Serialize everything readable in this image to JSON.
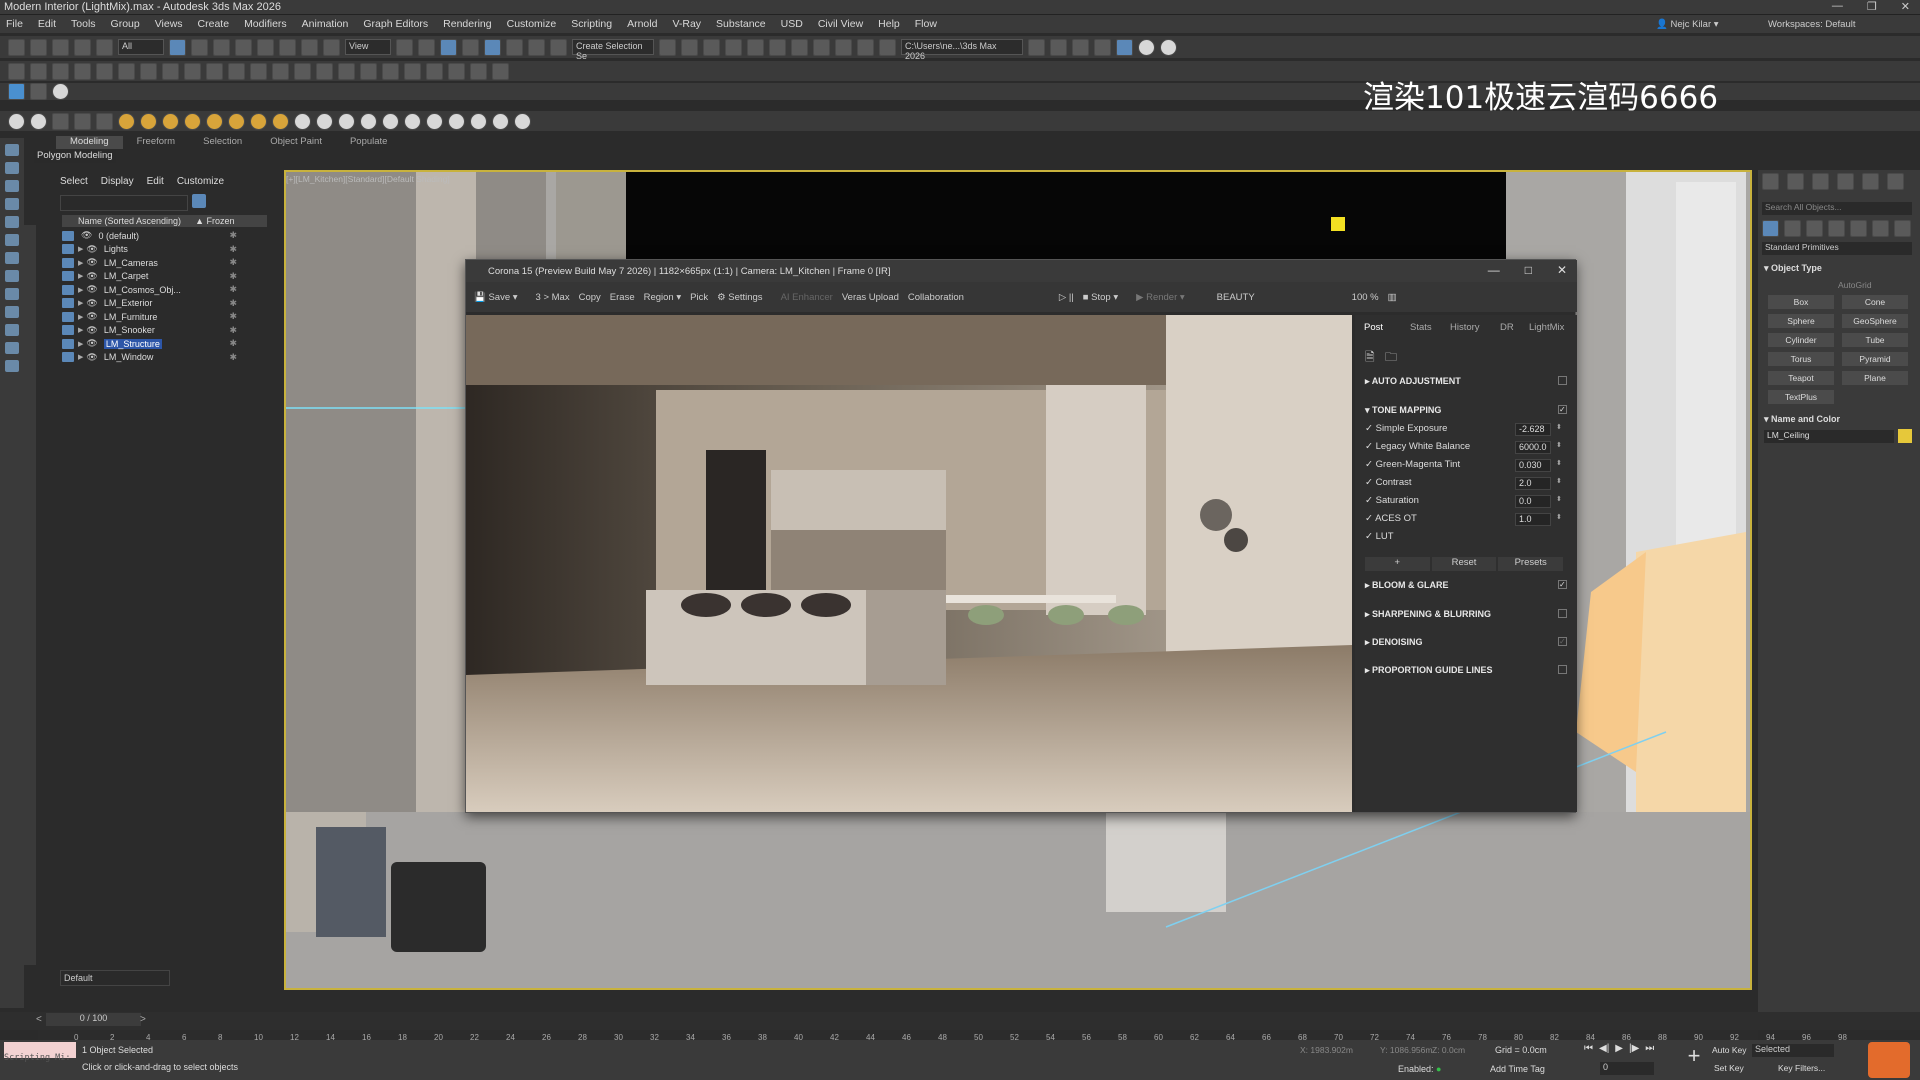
{
  "window": {
    "title": "Modern Interior (LightMix).max - Autodesk 3ds Max 2026",
    "controls": [
      "—",
      "❐",
      "✕"
    ]
  },
  "menu": [
    "File",
    "Edit",
    "Tools",
    "Group",
    "Views",
    "Create",
    "Modifiers",
    "Animation",
    "Graph Editors",
    "Rendering",
    "Customize",
    "Scripting",
    "Arnold",
    "V-Ray",
    "Substance",
    "USD",
    "Civil View",
    "Help",
    "Flow"
  ],
  "user": "Nejc Kilar",
  "workspaces_label": "Workspaces:",
  "workspace": "Default",
  "toolbar": {
    "filter": "All",
    "view": "View",
    "selection_set": "Create Selection Se",
    "path": "C:\\Users\\ne...\\3ds Max 2026"
  },
  "watermark": "渲染101极速云渲码6666",
  "ribbon_tabs": [
    "Modeling",
    "Freeform",
    "Selection",
    "Object Paint",
    "Populate"
  ],
  "ribbon_sub": "Polygon Modeling",
  "scene_explorer": {
    "tabs": [
      "Select",
      "Display",
      "Edit",
      "Customize"
    ],
    "col_name": "Name (Sorted Ascending)",
    "col_frozen": "▲ Frozen",
    "items": [
      "0 (default)",
      "Lights",
      "LM_Cameras",
      "LM_Carpet",
      "LM_Cosmos_Obj...",
      "LM_Exterior",
      "LM_Furniture",
      "LM_Snooker",
      "LM_Structure",
      "LM_Window"
    ],
    "selected": "LM_Structure",
    "layer": "Default"
  },
  "viewport": {
    "label": "[+][LM_Kitchen][Standard][Default Shading]"
  },
  "command_panel": {
    "search": "Search All Objects...",
    "category": "Standard Primitives",
    "object_type": "Object Type",
    "autogrid": "AutoGrid",
    "buttons": [
      "Box",
      "Cone",
      "Sphere",
      "GeoSphere",
      "Cylinder",
      "Tube",
      "Torus",
      "Pyramid",
      "Teapot",
      "Plane",
      "TextPlus"
    ],
    "name_color": "Name and Color",
    "name": "LM_Ceiling"
  },
  "vfb": {
    "title": "Corona 15 (Preview Build May 7 2026) | 1182×665px (1:1) | Camera: LM_Kitchen | Frame 0 [IR]",
    "toolbar": [
      "Save ▾",
      "3 > Max",
      "Copy",
      "Erase",
      "Region ▾",
      "Pick",
      "Settings",
      "AI Enhancer",
      "Veras Upload",
      "Collaboration"
    ],
    "stop": "Stop ▾",
    "render": "Render ▾",
    "pass": "BEAUTY",
    "zoom": "100 %",
    "tabs": [
      "Post",
      "Stats",
      "History",
      "DR",
      "LightMix"
    ],
    "sections": [
      "AUTO ADJUSTMENT",
      "TONE MAPPING",
      "BLOOM & GLARE",
      "SHARPENING & BLURRING",
      "DENOISING",
      "PROPORTION GUIDE LINES"
    ],
    "params": [
      {
        "name": "Simple Exposure",
        "value": "-2.628"
      },
      {
        "name": "Legacy White Balance",
        "value": "6000.0"
      },
      {
        "name": "Green-Magenta Tint",
        "value": "0.030"
      },
      {
        "name": "Contrast",
        "value": "2.0"
      },
      {
        "name": "Saturation",
        "value": "0.0"
      },
      {
        "name": "ACES OT",
        "value": "1.0"
      },
      {
        "name": "LUT",
        "value": ""
      }
    ],
    "plus": "+",
    "reset": "Reset",
    "presets": "Presets"
  },
  "timeline": {
    "frame": "0 / 100",
    "ticks": [
      "0",
      "2",
      "4",
      "6",
      "8",
      "10",
      "12",
      "14",
      "16",
      "18",
      "20",
      "22",
      "24",
      "26",
      "28",
      "30",
      "32",
      "34",
      "36",
      "38",
      "40",
      "42",
      "44",
      "46",
      "48",
      "50",
      "52",
      "54",
      "56",
      "58",
      "60",
      "62",
      "64",
      "66",
      "68",
      "70",
      "72",
      "74",
      "76",
      "78",
      "80",
      "82",
      "84",
      "86",
      "88",
      "90",
      "92",
      "94",
      "96",
      "98"
    ]
  },
  "status": {
    "script": "Scripting Mi:",
    "selected": "1 Object Selected",
    "hint": "Click or click-and-drag to select objects",
    "x": "X: 1983.902m",
    "y": "Y: 1086.956m",
    "z": "Z: 0.0cm",
    "grid": "Grid = 0.0cm",
    "enabled": "Enabled:",
    "add_time_tag": "Add Time Tag",
    "auto_key": "Auto Key",
    "set_key": "Set Key",
    "selected_dd": "Selected",
    "key_filters": "Key Filters...",
    "frame_num": "0"
  }
}
